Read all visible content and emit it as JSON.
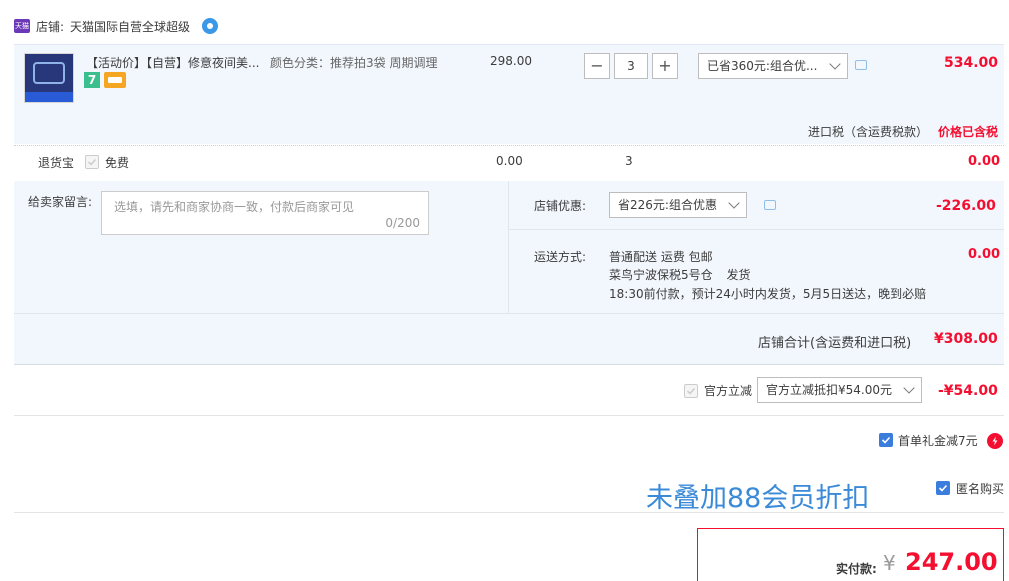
{
  "shop": {
    "label": "店铺:",
    "name": "天猫国际自营全球超级",
    "tmall_icon_text": "天猫"
  },
  "item": {
    "title": "【活动价】【自营】修意夜间美...",
    "spec": "颜色分类：推荐拍3袋 周期调理",
    "price": "298.00",
    "quantity": "3",
    "promo_select": "已省360元:组合优...",
    "subtotal": "534.00",
    "badge_text": "7"
  },
  "tax": {
    "label": "进口税（含运费税款）",
    "value": "价格已含税"
  },
  "return_insurance": {
    "label": "退货宝",
    "option": "免费",
    "price": "0.00",
    "qty": "3",
    "total": "0.00"
  },
  "message": {
    "label": "给卖家留言:",
    "placeholder": "选填，请先和商家协商一致，付款后商家可见",
    "counter": "0/200"
  },
  "shop_discount": {
    "label": "店铺优惠:",
    "select": "省226元:组合优惠",
    "amount": "-226.00"
  },
  "shipping": {
    "label": "运送方式:",
    "line1": "普通配送 运费 包邮",
    "line2": "菜鸟宁波保税5号仓",
    "line2b": "发货",
    "line3": "18:30前付款，预计24小时内发货，5月5日送达，晚到必赔",
    "amount": "0.00"
  },
  "shop_total": {
    "label": "店铺合计(含运费和进口税)",
    "amount": "¥308.00"
  },
  "official": {
    "label": "官方立减",
    "select": "官方立减抵扣¥54.00元",
    "amount": "-¥54.00"
  },
  "first_order": {
    "label": "首单礼金减7元"
  },
  "anonymous": {
    "label": "匿名购买"
  },
  "overlay_note": "未叠加88会员折扣",
  "payment": {
    "label": "实付款:",
    "currency": "¥",
    "amount": "247.00"
  },
  "colors": {
    "accent_red": "#f40f30",
    "link_blue": "#3b7ddd",
    "panel_bg": "#f2f7fd"
  }
}
